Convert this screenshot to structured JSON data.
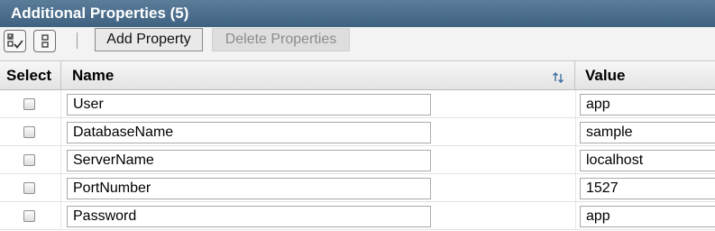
{
  "title": "Additional Properties (5)",
  "toolbar": {
    "select_all_icon": "select-all-icon",
    "deselect_all_icon": "deselect-all-icon",
    "add_label": "Add Property",
    "delete_label": "Delete Properties"
  },
  "table": {
    "headers": {
      "select": "Select",
      "name": "Name",
      "value": "Value"
    },
    "sort_icon": "sort-icon",
    "rows": [
      {
        "name": "User",
        "value": "app"
      },
      {
        "name": "DatabaseName",
        "value": "sample"
      },
      {
        "name": "ServerName",
        "value": "localhost"
      },
      {
        "name": "PortNumber",
        "value": "1527"
      },
      {
        "name": "Password",
        "value": "app"
      }
    ]
  },
  "colors": {
    "title_bar": "#4a6d8c",
    "title_text": "#ffffff",
    "header_bg": "#ececec",
    "disabled_text": "#8c8c8c"
  }
}
